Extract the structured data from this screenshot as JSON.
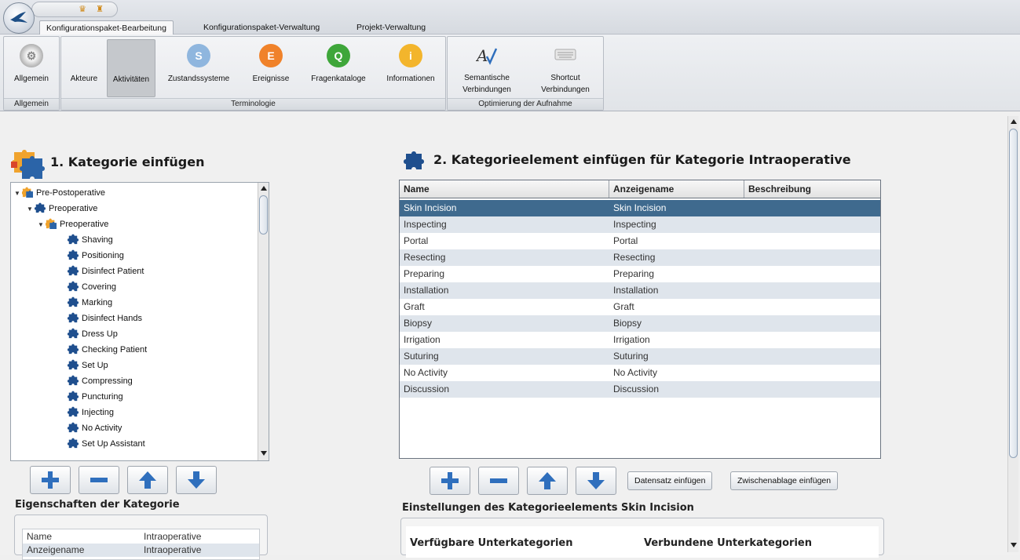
{
  "ribbon_tabs": [
    {
      "label": "Konfigurationspaket-Bearbeitung",
      "active": true
    },
    {
      "label": "Konfigurationspaket-Verwaltung",
      "active": false
    },
    {
      "label": "Projekt-Verwaltung",
      "active": false
    }
  ],
  "ribbon": {
    "groups": {
      "allgemein": "Allgemein",
      "terminologie": "Terminologie",
      "optimierung": "Optimierung der Aufnahme"
    },
    "buttons": {
      "allgemein": "Allgemein",
      "akteure": "Akteure",
      "aktivitaeten": "Aktivitäten",
      "zustandssysteme": "Zustandssysteme",
      "ereignisse": "Ereignisse",
      "fragenkataloge": "Fragenkataloge",
      "informationen": "Informationen",
      "semantische_1": "Semantische",
      "semantische_2": "Verbindungen",
      "shortcut_1": "Shortcut",
      "shortcut_2": "Verbindungen"
    },
    "icon_letters": {
      "zustand": "S",
      "ereignis": "E",
      "fragen": "Q",
      "info": "i"
    },
    "colors": {
      "zustand": "#8fb6de",
      "ereignis": "#f0822a",
      "fragen": "#3ea63a",
      "info": "#f3b52c",
      "accent_blue": "#2f6fbd"
    }
  },
  "left": {
    "heading": "1. Kategorie einfügen",
    "tree": [
      {
        "label": "Pre-Postoperative",
        "level": 0,
        "expanded": true,
        "multi": true
      },
      {
        "label": "Preoperative",
        "level": 1,
        "expanded": true,
        "multi": false
      },
      {
        "label": "Preoperative",
        "level": 2,
        "expanded": true,
        "multi": true
      },
      {
        "label": "Shaving",
        "level": 3
      },
      {
        "label": "Positioning",
        "level": 3
      },
      {
        "label": "Disinfect Patient",
        "level": 3
      },
      {
        "label": "Covering",
        "level": 3
      },
      {
        "label": "Marking",
        "level": 3
      },
      {
        "label": "Disinfect Hands",
        "level": 3
      },
      {
        "label": "Dress Up",
        "level": 3
      },
      {
        "label": "Checking Patient",
        "level": 3
      },
      {
        "label": "Set Up",
        "level": 3
      },
      {
        "label": "Compressing",
        "level": 3
      },
      {
        "label": "Puncturing",
        "level": 3
      },
      {
        "label": "Injecting",
        "level": 3
      },
      {
        "label": "No Activity",
        "level": 3
      },
      {
        "label": "Set Up Assistant",
        "level": 3
      }
    ],
    "props_heading": "Eigenschaften der Kategorie",
    "props": [
      {
        "key": "Name",
        "value": "Intraoperative"
      },
      {
        "key": "Anzeigename",
        "value": "Intraoperative"
      }
    ]
  },
  "right": {
    "heading": "2. Kategorieelement einfügen für Kategorie Intraoperative",
    "columns": [
      "Name",
      "Anzeigename",
      "Beschreibung"
    ],
    "rows": [
      {
        "name": "Skin Incision",
        "display": "Skin Incision",
        "desc": ""
      },
      {
        "name": "Inspecting",
        "display": "Inspecting",
        "desc": ""
      },
      {
        "name": "Portal",
        "display": "Portal",
        "desc": ""
      },
      {
        "name": "Resecting",
        "display": "Resecting",
        "desc": ""
      },
      {
        "name": "Preparing",
        "display": "Preparing",
        "desc": ""
      },
      {
        "name": "Installation",
        "display": "Installation",
        "desc": ""
      },
      {
        "name": "Graft",
        "display": "Graft",
        "desc": ""
      },
      {
        "name": "Biopsy",
        "display": "Biopsy",
        "desc": ""
      },
      {
        "name": "Irrigation",
        "display": "Irrigation",
        "desc": ""
      },
      {
        "name": "Suturing",
        "display": "Suturing",
        "desc": ""
      },
      {
        "name": "No Activity",
        "display": "No Activity",
        "desc": ""
      },
      {
        "name": "Discussion",
        "display": "Discussion",
        "desc": ""
      }
    ],
    "btn_datensatz": "Datensatz einfügen",
    "btn_zwischenablage": "Zwischenablage einfügen",
    "settings_heading": "Einstellungen des Kategorieelements Skin Incision",
    "available_label": "Verfügbare Unterkategorien",
    "connected_label": "Verbundene Unterkategorien"
  }
}
